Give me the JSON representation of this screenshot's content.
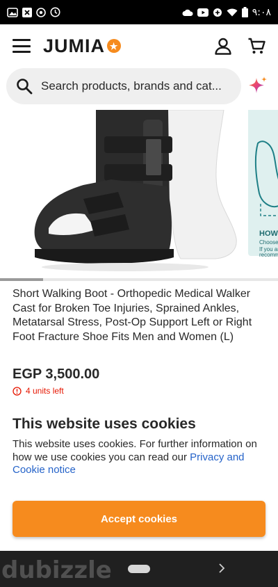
{
  "status_bar": {
    "time": "٩:٠٨",
    "icons": [
      "gallery-icon",
      "close-icon",
      "whatsapp-icon",
      "clock-icon",
      "cloud-icon",
      "youtube-icon",
      "battery-saver-icon",
      "wifi-icon",
      "battery-icon"
    ]
  },
  "header": {
    "logo_text": "JUMIA",
    "logo_star": "★"
  },
  "search": {
    "placeholder": "Search products, brands and cat..."
  },
  "gallery": {
    "second_image_heading": "HOW",
    "second_image_lines": [
      "Choose",
      "If you ar",
      "recomm"
    ]
  },
  "product": {
    "title": "Short Walking Boot - Orthopedic Medical Walker Cast for Broken Toe Injuries, Sprained Ankles, Metatarsal Stress, Post-Op Support Left or Right Foot Fracture Shoe Fits Men and Women (L)",
    "price": "EGP 3,500.00",
    "stock": "4 units left"
  },
  "cookies": {
    "title": "This website uses cookies",
    "text": "This website uses cookies. For further information on how we use cookies you can read our ",
    "link": "Privacy and Cookie notice",
    "accept_label": "Accept cookies"
  },
  "watermark": {
    "text": "dubizzle"
  },
  "colors": {
    "brand_orange": "#f68b1e",
    "link_blue": "#2563c9",
    "stock_red": "#e61601"
  }
}
